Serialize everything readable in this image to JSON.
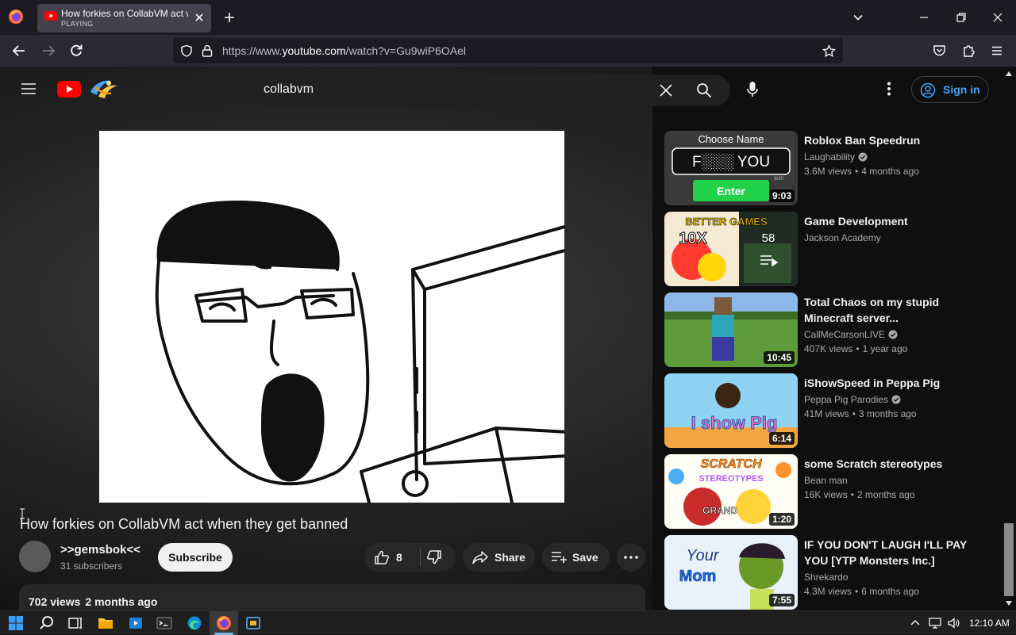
{
  "browser": {
    "tab": {
      "title": "How forkies on CollabVM act w",
      "status": "PLAYING"
    },
    "url": {
      "prefix": "https://www.",
      "host": "youtube.com",
      "path": "/watch?v=Gu9wiP6OAel"
    }
  },
  "header": {
    "search_value": "collabvm",
    "sign_in": "Sign in"
  },
  "video": {
    "title": "How forkies on CollabVM act when they get banned",
    "channel": ">>gemsbok<<",
    "subscribers": "31 subscribers",
    "subscribe_label": "Subscribe",
    "likes": "8",
    "share_label": "Share",
    "save_label": "Save",
    "views": "702 views",
    "age": "2 months ago"
  },
  "recommendations": [
    {
      "title": "Roblox Ban Speedrun",
      "channel": "Laughability",
      "verified": true,
      "views": "3.6M views",
      "age": "4 months ago",
      "duration": "9:03",
      "thumb_text": {
        "heading": "Choose Name",
        "name": "F░░░ YOU",
        "counter": "8/20",
        "button": "Enter"
      }
    },
    {
      "title": "Game Development",
      "channel": "Jackson Academy",
      "verified": false,
      "views": "",
      "age": "",
      "duration": "",
      "thumb_text": {
        "banner": "BETTER GAMES",
        "multiplier": "10X",
        "count": "58"
      }
    },
    {
      "title": "Total Chaos on my stupid Minecraft server...",
      "channel": "CallMeCarsonLIVE",
      "verified": true,
      "views": "407K views",
      "age": "1 year ago",
      "duration": "10:45"
    },
    {
      "title": "iShowSpeed in Peppa Pig",
      "channel": "Peppa Pig Parodies",
      "verified": true,
      "views": "41M views",
      "age": "3 months ago",
      "duration": "6:14",
      "thumb_text": {
        "word": "I show Pig"
      }
    },
    {
      "title": "some Scratch stereotypes",
      "channel": "Bean man",
      "verified": false,
      "views": "16K views",
      "age": "2 months ago",
      "duration": "1:20",
      "thumb_text": {
        "line1": "SCRATCH",
        "line2": "STEREOTYPES",
        "tag": "GRAND"
      }
    },
    {
      "title": "IF YOU DON'T LAUGH I'LL PAY YOU [YTP Monsters Inc.]",
      "channel": "Shrekardo",
      "verified": false,
      "views": "4.3M views",
      "age": "6 months ago",
      "duration": "7:55",
      "thumb_text": {
        "line1": "Your",
        "line2": "Mom"
      }
    }
  ],
  "taskbar": {
    "time": "12:10 AM"
  },
  "colors": {
    "accent_link": "#3ea6ff",
    "yt_red": "#ff0000",
    "browser_dark": "#1c1b22",
    "page_bg": "#0f0f0f"
  }
}
